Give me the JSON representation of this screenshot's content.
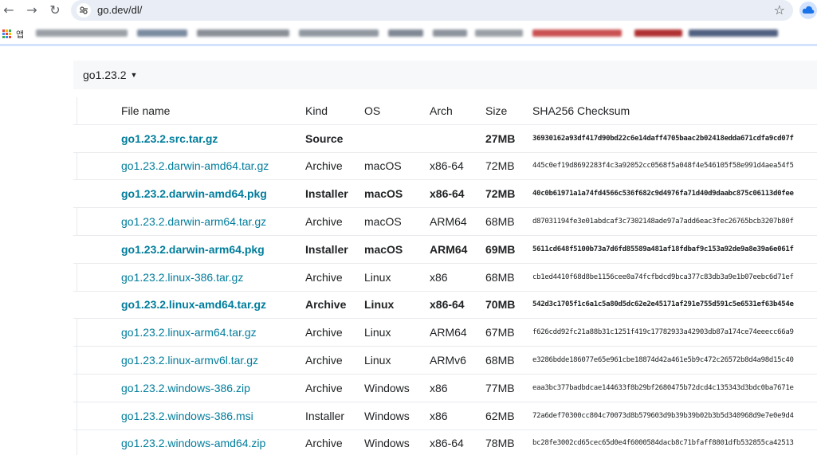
{
  "browser": {
    "url": "go.dev/dl/",
    "bookmarks_label": "앱",
    "blurred_bookmarks": [
      {
        "color": "#9aa0a6"
      },
      {
        "color": "#7a8aa0"
      },
      {
        "color": "#8a8f96"
      },
      {
        "color": "#9097a0"
      },
      {
        "color": "#7f8894"
      },
      {
        "color": "#8c939c"
      },
      {
        "color": "#9aa0a6"
      },
      {
        "color": "#c95050"
      },
      {
        "color": "#b03030"
      },
      {
        "color": "#506080"
      }
    ]
  },
  "version_selector": {
    "label": "go1.23.2"
  },
  "table": {
    "headers": [
      "File name",
      "Kind",
      "OS",
      "Arch",
      "Size",
      "SHA256 Checksum"
    ],
    "rows": [
      {
        "file": "go1.23.2.src.tar.gz",
        "kind": "Source",
        "os": "",
        "arch": "",
        "size": "27MB",
        "sha": "36930162a93df417d90bd22c6e14daff4705baac2b02418edda671cdfa9cd07f",
        "featured": true
      },
      {
        "file": "go1.23.2.darwin-amd64.tar.gz",
        "kind": "Archive",
        "os": "macOS",
        "arch": "x86-64",
        "size": "72MB",
        "sha": "445c0ef19d8692283f4c3a92052cc0568f5a048f4e546105f58e991d4aea54f5",
        "featured": false
      },
      {
        "file": "go1.23.2.darwin-amd64.pkg",
        "kind": "Installer",
        "os": "macOS",
        "arch": "x86-64",
        "size": "72MB",
        "sha": "40c0b61971a1a74fd4566c536f682c9d4976fa71d40d9daabc875c06113d0fee",
        "featured": true
      },
      {
        "file": "go1.23.2.darwin-arm64.tar.gz",
        "kind": "Archive",
        "os": "macOS",
        "arch": "ARM64",
        "size": "68MB",
        "sha": "d87031194fe3e01abdcaf3c7302148ade97a7add6eac3fec26765bcb3207b80f",
        "featured": false
      },
      {
        "file": "go1.23.2.darwin-arm64.pkg",
        "kind": "Installer",
        "os": "macOS",
        "arch": "ARM64",
        "size": "69MB",
        "sha": "5611cd648f5100b73a7d6fd85589a481af18fdbaf9c153a92de9a8e39a6e061f",
        "featured": true
      },
      {
        "file": "go1.23.2.linux-386.tar.gz",
        "kind": "Archive",
        "os": "Linux",
        "arch": "x86",
        "size": "68MB",
        "sha": "cb1ed4410f68d8be1156cee0a74fcfbdcd9bca377c83db3a9e1b07eebc6d71ef",
        "featured": false
      },
      {
        "file": "go1.23.2.linux-amd64.tar.gz",
        "kind": "Archive",
        "os": "Linux",
        "arch": "x86-64",
        "size": "70MB",
        "sha": "542d3c1705f1c6a1c5a80d5dc62e2e45171af291e755d591c5e6531ef63b454e",
        "featured": true
      },
      {
        "file": "go1.23.2.linux-arm64.tar.gz",
        "kind": "Archive",
        "os": "Linux",
        "arch": "ARM64",
        "size": "67MB",
        "sha": "f626cdd92fc21a88b31c1251f419c17782933a42903db87a174ce74eeecc66a9",
        "featured": false
      },
      {
        "file": "go1.23.2.linux-armv6l.tar.gz",
        "kind": "Archive",
        "os": "Linux",
        "arch": "ARMv6",
        "size": "68MB",
        "sha": "e3286bdde186077e65e961cbe18874d42a461e5b9c472c26572b8d4a98d15c40",
        "featured": false
      },
      {
        "file": "go1.23.2.windows-386.zip",
        "kind": "Archive",
        "os": "Windows",
        "arch": "x86",
        "size": "77MB",
        "sha": "eaa3bc377badbdcae144633f8b29bf2680475b72dcd4c135343d3bdc0ba7671e",
        "featured": false
      },
      {
        "file": "go1.23.2.windows-386.msi",
        "kind": "Installer",
        "os": "Windows",
        "arch": "x86",
        "size": "62MB",
        "sha": "72a6def70300cc804c70073d8b579603d9b39b39b02b3b5d340968d9e7e0e9d4",
        "featured": false
      },
      {
        "file": "go1.23.2.windows-amd64.zip",
        "kind": "Archive",
        "os": "Windows",
        "arch": "x86-64",
        "size": "78MB",
        "sha": "bc28fe3002cd65cec65d0e4f6000584dacb8c71bfaff8801dfb532855ca42513",
        "featured": false
      }
    ]
  },
  "colors": {
    "link": "#007d9c",
    "omnibox": "#e9eef6",
    "header_bg": "#f7f8f9"
  }
}
